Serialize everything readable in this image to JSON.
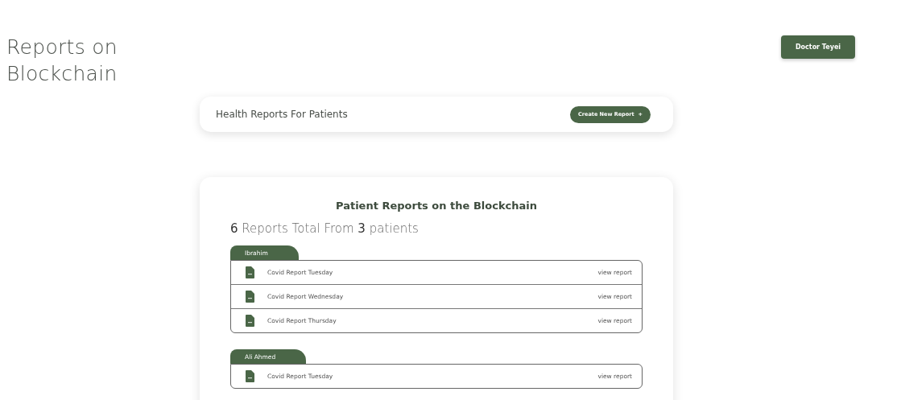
{
  "page_title": "Reports on Blockchain",
  "user_button": "Doctor Teyei",
  "toolbar": {
    "title": "Health Reports For Patients",
    "create_button": "Create New Report",
    "create_icon": "+"
  },
  "reports_card": {
    "title": "Patient Reports on the Blockchain",
    "summary": "**6** Reports Total From **3** patients",
    "patients": [
      {
        "name": "Ibrahim",
        "reports": [
          {
            "title": "Covid Report Tuesday",
            "link": "view report"
          },
          {
            "title": "Covid Report Wednesday",
            "link": "view report"
          },
          {
            "title": "Covid Report Thursday",
            "link": "view report"
          }
        ]
      },
      {
        "name": "Ali Ahmed",
        "reports": [
          {
            "title": "Covid Report Tuesday",
            "link": "view report"
          }
        ]
      }
    ]
  }
}
